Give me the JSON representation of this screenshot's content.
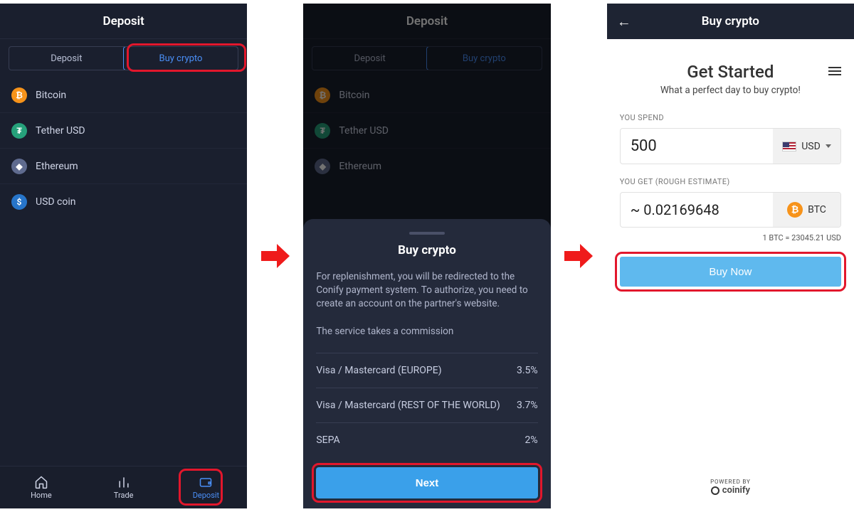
{
  "arrows_color": "#ef1b1b",
  "screen1": {
    "title": "Deposit",
    "tabs": [
      "Deposit",
      "Buy crypto"
    ],
    "active_tab_index": 1,
    "coins": [
      {
        "name": "Bitcoin",
        "color": "#f7931a",
        "sym": "₿"
      },
      {
        "name": "Tether USD",
        "color": "#26a17b",
        "sym": "T"
      },
      {
        "name": "Ethereum",
        "color": "#5f6b8f",
        "sym": "Ξ"
      },
      {
        "name": "USD coin",
        "color": "#2775ca",
        "sym": "$"
      }
    ],
    "nav": [
      {
        "label": "Home"
      },
      {
        "label": "Trade"
      },
      {
        "label": "Deposit"
      }
    ],
    "active_nav_index": 2
  },
  "screen2": {
    "title": "Deposit",
    "tabs": [
      "Deposit",
      "Buy crypto"
    ],
    "sheet": {
      "title": "Buy crypto",
      "desc": "For replenishment, you will be redirected to the Conify payment system. To authorize, you need to create an account on the partner's website.",
      "commission_note": "The service takes a commission",
      "fees": [
        {
          "label": "Visa / Mastercard (EUROPE)",
          "value": "3.5%"
        },
        {
          "label": "Visa / Mastercard (REST OF THE WORLD)",
          "value": "3.7%"
        },
        {
          "label": "SEPA",
          "value": "2%"
        }
      ],
      "next_label": "Next"
    }
  },
  "screen3": {
    "title": "Buy crypto",
    "heading": "Get Started",
    "subheading": "What a perfect day to buy crypto!",
    "spend_label": "YOU SPEND",
    "spend_value": "500",
    "spend_currency": "USD",
    "get_label": "YOU GET (ROUGH ESTIMATE)",
    "get_value": "~ 0.02169648",
    "get_currency": "BTC",
    "rate_text": "1 BTC = 23045.21 USD",
    "buy_label": "Buy Now",
    "powered_label": "POWERED BY",
    "powered_brand": "coinify"
  }
}
